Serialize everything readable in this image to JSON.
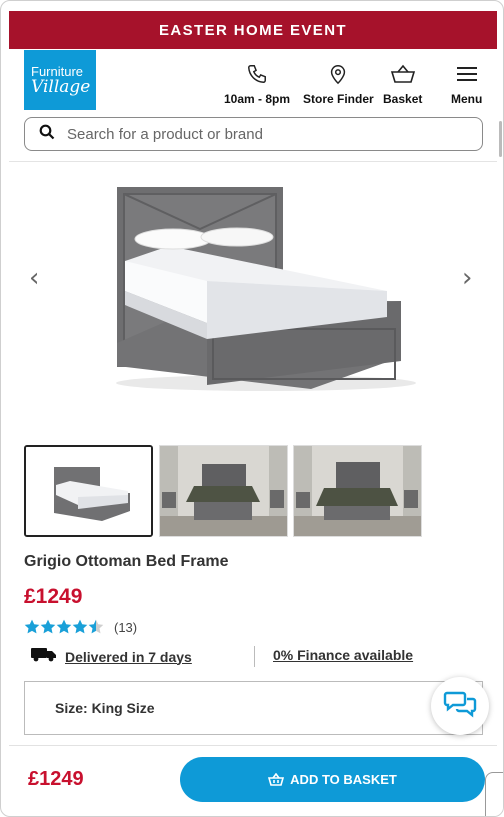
{
  "promo": {
    "text": "EASTER HOME EVENT"
  },
  "header": {
    "logo": {
      "line1": "Furniture",
      "line2": "Village"
    },
    "nav": [
      {
        "label": "10am - 8pm",
        "icon": "phone-icon"
      },
      {
        "label": "Store Finder",
        "icon": "location-pin-icon"
      },
      {
        "label": "Basket",
        "icon": "basket-icon"
      },
      {
        "label": "Menu",
        "icon": "hamburger-menu-icon"
      }
    ]
  },
  "search": {
    "placeholder": "Search for a product or brand",
    "icon": "search-icon"
  },
  "gallery": {
    "prev_icon": "chevron-left-icon",
    "next_icon": "chevron-right-icon",
    "thumbnails": [
      {
        "label": "studio",
        "active": true
      },
      {
        "label": "room-open",
        "active": false
      },
      {
        "label": "room-closed",
        "active": false
      }
    ]
  },
  "product": {
    "title": "Grigio Ottoman Bed Frame",
    "price": "£1249",
    "rating": 4.5,
    "rating_max": 5,
    "review_count": "(13)",
    "delivery_text": "Delivered in 7 days",
    "finance_text": "0% Finance available",
    "size_label": "Size: King Size"
  },
  "sticky_bar": {
    "price": "£1249",
    "add_label": "ADD TO BASKET"
  },
  "colors": {
    "brand_blue": "#0e9ad7",
    "promo_red": "#a6122b",
    "price_red": "#c8102e",
    "star": "#1aa0d8"
  }
}
